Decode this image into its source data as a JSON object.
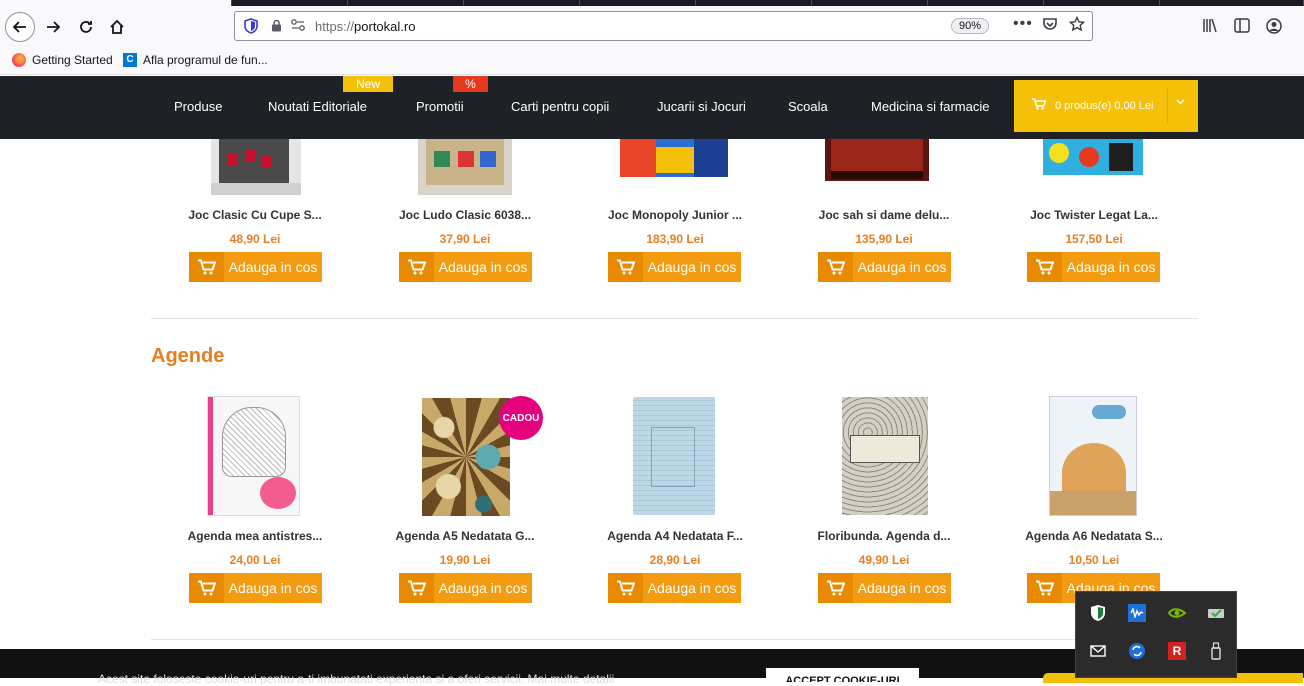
{
  "browser": {
    "url_protocol": "https://",
    "url_host": "portokal.ro",
    "zoom": "90%",
    "bookmarks": [
      {
        "label": "Getting Started",
        "icon": "firefox-icon"
      },
      {
        "label": "Afla programul de fun...",
        "icon": "site-favicon"
      }
    ]
  },
  "site_nav": {
    "items": [
      "Produse",
      "Noutati Editoriale",
      "Promotii",
      "Carti pentru copii",
      "Jucarii si Jocuri",
      "Scoala",
      "Medicina si farmacie"
    ],
    "badge_new": "New",
    "badge_promo": "%",
    "cart_label": "0 produs(e) 0,00 Lei"
  },
  "games": [
    {
      "name": "Joc Clasic Cu Cupe S...",
      "price": "48,90 Lei",
      "button": "Adauga in cos"
    },
    {
      "name": "Joc Ludo Clasic 6038...",
      "price": "37,90 Lei",
      "button": "Adauga in cos"
    },
    {
      "name": "Joc Monopoly Junior ...",
      "price": "183,90 Lei",
      "button": "Adauga in cos"
    },
    {
      "name": "Joc sah si dame delu...",
      "price": "135,90 Lei",
      "button": "Adauga in cos"
    },
    {
      "name": "Joc Twister Legat La...",
      "price": "157,50 Lei",
      "button": "Adauga in cos"
    }
  ],
  "agende_section": {
    "title": "Agende",
    "gift_badge": "CADOU",
    "products": [
      {
        "name": "Agenda mea antistres...",
        "price": "24,00 Lei",
        "button": "Adauga in cos"
      },
      {
        "name": "Agenda A5 Nedatata G...",
        "price": "19,90 Lei",
        "button": "Adauga in cos"
      },
      {
        "name": "Agenda A4 Nedatata F...",
        "price": "28,90 Lei",
        "button": "Adauga in cos"
      },
      {
        "name": "Floribunda. Agenda d...",
        "price": "49,90 Lei",
        "button": "Adauga in cos"
      },
      {
        "name": "Agenda A6 Nedatata S...",
        "price": "10,50 Lei",
        "button": "Adauga in cos"
      }
    ]
  },
  "cookie_bar": {
    "text": "Acest site foloseste cookie-uri pentru a-ti imbunatati experienta si a oferi servicii. Mai multe detalii",
    "accept_label": "ACCEPT COOKIE-URI"
  },
  "colors": {
    "accent_orange": "#f39c12",
    "price_orange": "#e67e22",
    "nav_bg": "#1e2126",
    "cart_yellow": "#f5c108",
    "badge_pink": "#e5007e"
  }
}
